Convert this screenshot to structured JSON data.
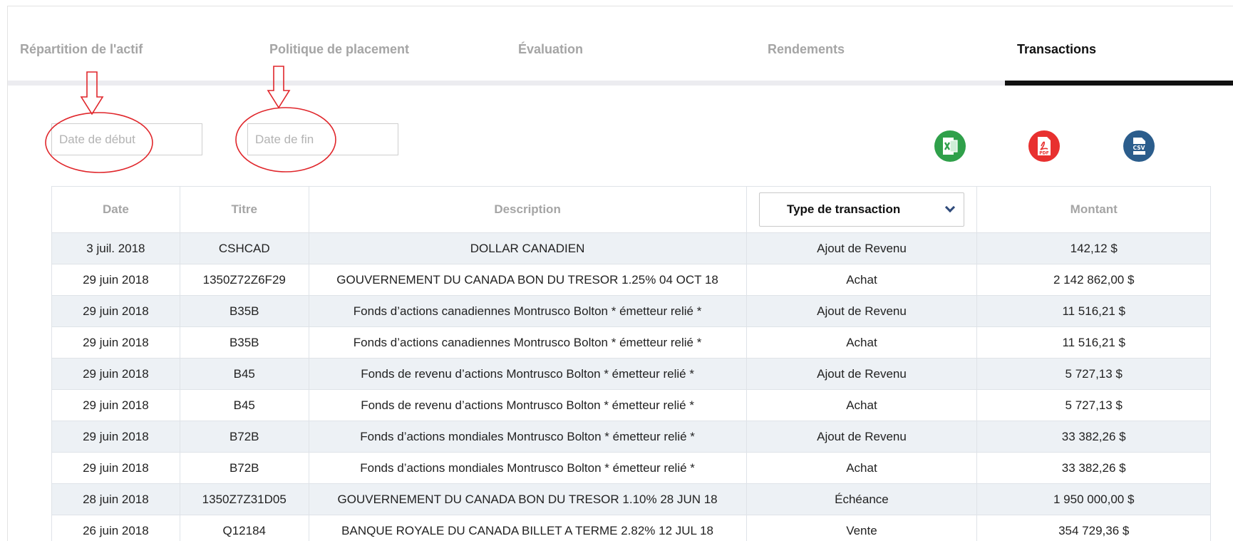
{
  "tabs": [
    {
      "label": "Répartition de l'actif"
    },
    {
      "label": "Politique de placement"
    },
    {
      "label": "Évaluation"
    },
    {
      "label": "Rendements"
    },
    {
      "label": "Transactions"
    }
  ],
  "active_tab": "Transactions",
  "filters": {
    "start_date_placeholder": "Date de début",
    "end_date_placeholder": "Date de fin"
  },
  "exports": {
    "excel_icon": "excel-icon",
    "pdf_icon": "pdf-icon",
    "pdf_text": "PDF",
    "csv_icon": "csv-icon",
    "csv_text": "CSV",
    "excel_color": "#2fa04a",
    "pdf_color": "#e8302f",
    "csv_color": "#2b5d8c"
  },
  "annotation_color": "#e0262b",
  "table": {
    "headers": {
      "date": "Date",
      "titre": "Titre",
      "description": "Description",
      "type": "Type de transaction",
      "montant": "Montant"
    },
    "rows": [
      {
        "date": "3 juil. 2018",
        "titre": "CSHCAD",
        "description": "DOLLAR CANADIEN",
        "type": "Ajout de Revenu",
        "montant": "142,12 $"
      },
      {
        "date": "29 juin 2018",
        "titre": "1350Z72Z6F29",
        "description": "GOUVERNEMENT DU CANADA BON DU TRESOR 1.25% 04 OCT 18",
        "type": "Achat",
        "montant": "2 142 862,00 $"
      },
      {
        "date": "29 juin 2018",
        "titre": "B35B",
        "description": "Fonds d’actions canadiennes Montrusco Bolton * émetteur relié *",
        "type": "Ajout de Revenu",
        "montant": "11 516,21 $"
      },
      {
        "date": "29 juin 2018",
        "titre": "B35B",
        "description": "Fonds d’actions canadiennes Montrusco Bolton * émetteur relié *",
        "type": "Achat",
        "montant": "11 516,21 $"
      },
      {
        "date": "29 juin 2018",
        "titre": "B45",
        "description": "Fonds de revenu d’actions Montrusco Bolton * émetteur relié *",
        "type": "Ajout de Revenu",
        "montant": "5 727,13 $"
      },
      {
        "date": "29 juin 2018",
        "titre": "B45",
        "description": "Fonds de revenu d’actions Montrusco Bolton * émetteur relié *",
        "type": "Achat",
        "montant": "5 727,13 $"
      },
      {
        "date": "29 juin 2018",
        "titre": "B72B",
        "description": "Fonds d’actions mondiales Montrusco Bolton * émetteur relié *",
        "type": "Ajout de Revenu",
        "montant": "33 382,26 $"
      },
      {
        "date": "29 juin 2018",
        "titre": "B72B",
        "description": "Fonds d’actions mondiales Montrusco Bolton * émetteur relié *",
        "type": "Achat",
        "montant": "33 382,26 $"
      },
      {
        "date": "28 juin 2018",
        "titre": "1350Z7Z31D05",
        "description": "GOUVERNEMENT DU CANADA BON DU TRESOR 1.10% 28 JUN 18",
        "type": "Échéance",
        "montant": "1 950 000,00 $"
      },
      {
        "date": "26 juin 2018",
        "titre": "Q12184",
        "description": "BANQUE ROYALE DU CANADA BILLET A TERME 2.82% 12 JUL 18",
        "type": "Vente",
        "montant": "354 729,36 $"
      }
    ]
  }
}
